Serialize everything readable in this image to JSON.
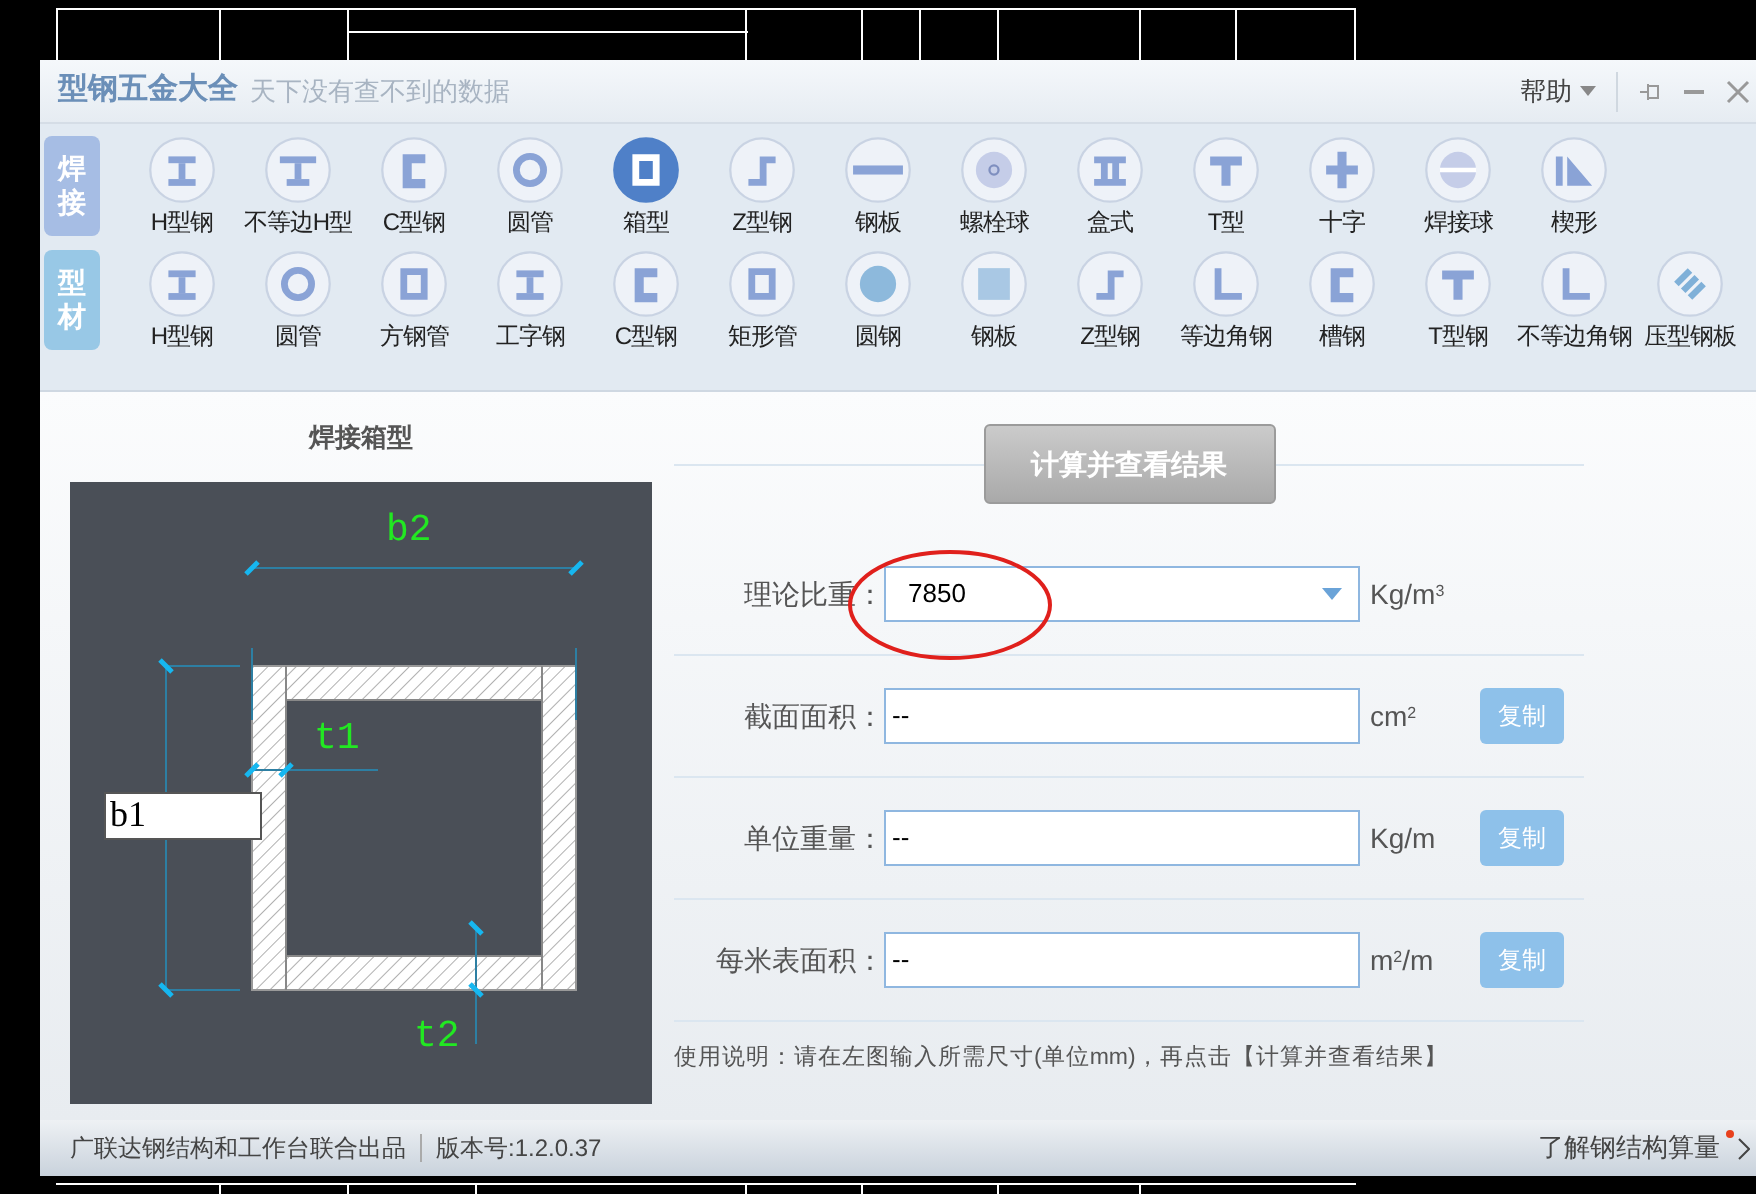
{
  "window": {
    "title": "型钢五金大全",
    "subtitle": "天下没有查不到的数据",
    "help_menu": "帮助"
  },
  "toolbar_groups": [
    {
      "label": "焊接",
      "items": [
        {
          "label": "H型钢",
          "kind": "ibeam",
          "selected": false
        },
        {
          "label": "不等边H型",
          "kind": "tbeam",
          "selected": false
        },
        {
          "label": "C型钢",
          "kind": "channel",
          "selected": false
        },
        {
          "label": "圆管",
          "kind": "ring",
          "selected": false
        },
        {
          "label": "箱型",
          "kind": "box",
          "selected": true
        },
        {
          "label": "Z型钢",
          "kind": "zee",
          "selected": false
        },
        {
          "label": "钢板",
          "kind": "plate",
          "selected": false
        },
        {
          "label": "螺栓球",
          "kind": "ballbolt",
          "selected": false
        },
        {
          "label": "盒式",
          "kind": "doubletee",
          "selected": false
        },
        {
          "label": "T型",
          "kind": "tee",
          "selected": false
        },
        {
          "label": "十字",
          "kind": "cross",
          "selected": false
        },
        {
          "label": "焊接球",
          "kind": "weldball",
          "selected": false
        },
        {
          "label": "楔形",
          "kind": "wedge",
          "selected": false
        }
      ]
    },
    {
      "label": "型材",
      "items": [
        {
          "label": "H型钢",
          "kind": "ibeam",
          "selected": false
        },
        {
          "label": "圆管",
          "kind": "ring",
          "selected": false
        },
        {
          "label": "方钢管",
          "kind": "box",
          "selected": false
        },
        {
          "label": "工字钢",
          "kind": "ibeam",
          "selected": false
        },
        {
          "label": "C型钢",
          "kind": "channel",
          "selected": false
        },
        {
          "label": "矩形管",
          "kind": "box",
          "selected": false
        },
        {
          "label": "圆钢",
          "kind": "disc",
          "selected": false
        },
        {
          "label": "钢板",
          "kind": "dotted",
          "selected": false
        },
        {
          "label": "Z型钢",
          "kind": "zee",
          "selected": false
        },
        {
          "label": "等边角钢",
          "kind": "angle",
          "selected": false
        },
        {
          "label": "槽钢",
          "kind": "channel",
          "selected": false
        },
        {
          "label": "T型钢",
          "kind": "tee",
          "selected": false
        },
        {
          "label": "不等边角钢",
          "kind": "angle",
          "selected": false
        },
        {
          "label": "压型钢板",
          "kind": "stripes",
          "selected": false
        }
      ]
    }
  ],
  "diagram": {
    "title": "焊接箱型",
    "b2": "b2",
    "t1": "t1",
    "b1": "b1",
    "t2": "t2"
  },
  "calculate_button": "计算并查看结果",
  "fields": [
    {
      "label": "理论比重：",
      "value": "7850",
      "unit": "Kg/m$^{3}$",
      "kind": "dropdown"
    },
    {
      "label": "截面面积：",
      "value": "--",
      "unit": "cm$^{2}$",
      "kind": "result",
      "copy": "复制"
    },
    {
      "label": "单位重量：",
      "value": "--",
      "unit": "Kg/m",
      "kind": "result",
      "copy": "复制"
    },
    {
      "label": "每米表面积：",
      "value": "--",
      "unit": "m$^{2}$/m",
      "kind": "result",
      "copy": "复制"
    }
  ],
  "instructions": "使用说明：请在左图输入所需尺寸(单位mm)，再点击【计算并查看结果】",
  "status_bar": {
    "credit": "广联达钢结构和工作台联合出品",
    "version": "版本号:1.2.0.37",
    "link": "了解钢结构算量"
  }
}
